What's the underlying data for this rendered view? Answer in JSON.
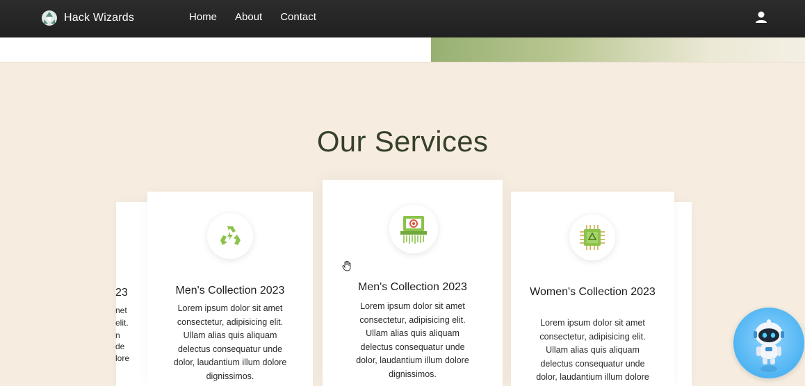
{
  "navbar": {
    "brand": "Hack Wizards",
    "links": [
      "Home",
      "About",
      "Contact"
    ]
  },
  "section": {
    "title": "Our Services"
  },
  "cards": [
    {
      "title": "Men's Collection 2023",
      "text": "Lorem ipsum dolor sit amet consectetur, adipisicing elit. Ullam alias quis aliquam delectus consequatur unde dolor, laudantium illum dolore dignissimos.",
      "icon": "recycle-icon"
    },
    {
      "title": "Men's Collection 2023",
      "text": "Lorem ipsum dolor sit amet consectetur, adipisicing elit. Ullam alias quis aliquam delectus consequatur unde dolor, laudantium illum dolore dignissimos.",
      "icon": "shredder-icon"
    },
    {
      "title": "Women's Collection 2023",
      "text": "Lorem ipsum dolor sit amet consectetur, adipisicing elit. Ullam alias quis aliquam delectus consequatur unde dolor, laudantium illum dolore dignissimos.",
      "icon": "chip-recycle-icon"
    }
  ],
  "partial_card": {
    "title": "23",
    "lines": [
      "net",
      "elit.",
      "n",
      "de",
      "lore"
    ]
  },
  "colors": {
    "navbar": "#262626",
    "page_bg": "#f6ede0",
    "accent_green": "#8cc34a",
    "title": "#36402a"
  }
}
